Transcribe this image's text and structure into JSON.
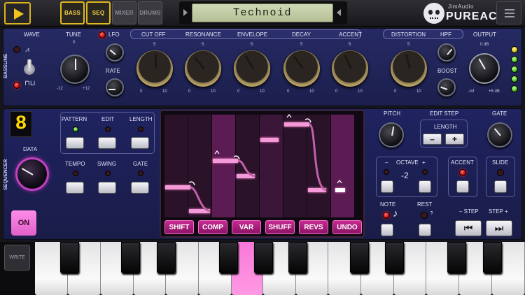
{
  "topbar": {
    "modes": [
      "BASS",
      "SEQ",
      "MIXER",
      "DRUMS"
    ],
    "display_text": "Technoid",
    "brand_top": "JimAudio",
    "brand_name": "PUREACID"
  },
  "synth": {
    "side_label": "BASSLINE",
    "labels": {
      "wave": "WAVE",
      "tune": "TUNE",
      "lfo": "LFO",
      "rate": "RATE",
      "cutoff": "CUT OFF",
      "resonance": "RESONANCE",
      "envelope": "ENVELOPE",
      "decay": "DECAY",
      "accent": "ACCENT",
      "distortion": "DISTORTION",
      "hpf": "HPF",
      "boost": "BOOST",
      "output": "OUTPUT"
    },
    "scale": {
      "zero": "0",
      "five": "5",
      "ten": "10",
      "tune_min": "-12",
      "tune_max": "+12",
      "out_top": "0 dB",
      "out_min": "-inf",
      "out_max": "+6 dB"
    }
  },
  "sequencer": {
    "side_label": "SEQUENCER",
    "pattern_number": "8",
    "labels": {
      "pattern": "PATTERN",
      "edit": "EDIT",
      "length": "LENGTH",
      "tempo": "TEMPO",
      "swing": "SWING",
      "gate": "GATE",
      "data": "DATA",
      "on": "ON",
      "pitch": "PITCH",
      "edit_step": "EDIT STEP",
      "step_length": "LENGTH",
      "step_gate": "GATE",
      "octave": "OCTAVE",
      "accent": "ACCENT",
      "slide": "SLIDE",
      "note": "NOTE",
      "rest": "REST",
      "step_minus": "– STEP",
      "step_plus": "STEP +"
    },
    "octave_value": "-2",
    "octave_minus": "–",
    "octave_plus": "+",
    "length_minus": "–",
    "length_plus": "+",
    "fx_buttons": [
      "SHIFT",
      "COMP",
      "VAR",
      "SHUFF",
      "REVS",
      "UNDO"
    ]
  },
  "keyboard": {
    "write_label": "WRITE"
  },
  "colors": {
    "accent_yellow": "#f0c41c",
    "sequencer_pink": "#e060c8",
    "panel_navy": "#1f2360"
  }
}
